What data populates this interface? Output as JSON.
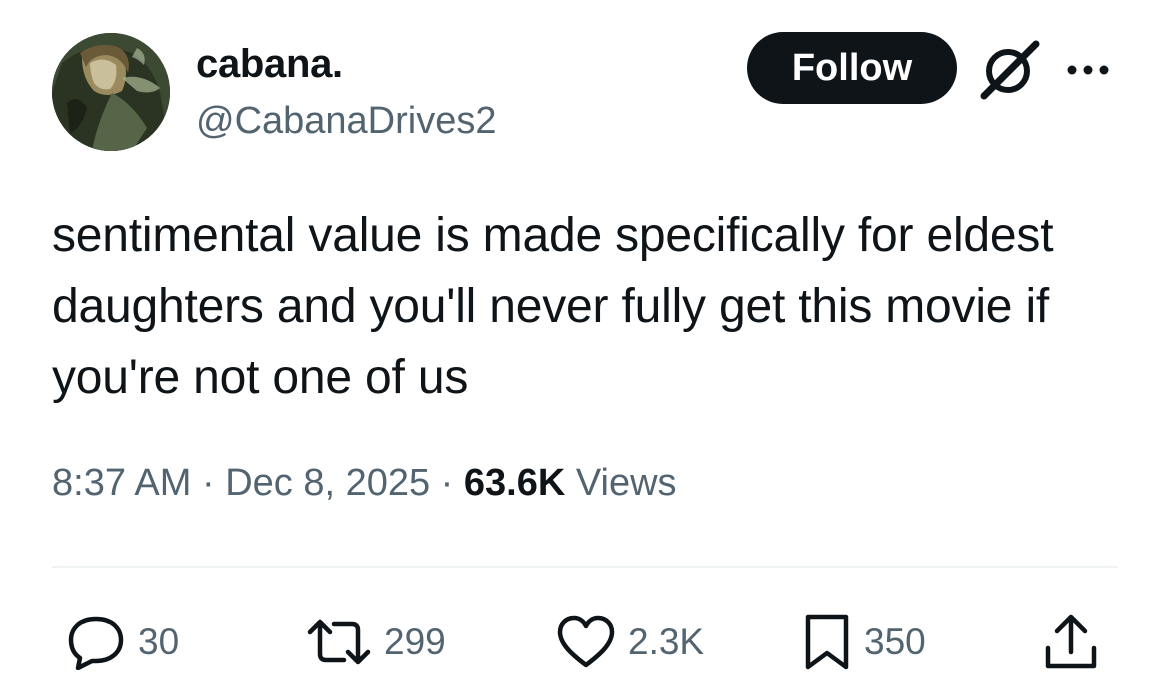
{
  "author": {
    "display_name": "cabana.",
    "handle": "@CabanaDrives2",
    "avatar_icon": "anime-character-avatar"
  },
  "header_actions": {
    "follow_label": "Follow",
    "grok_icon": "grok-icon",
    "more_icon": "more-icon"
  },
  "tweet": {
    "text": "sentimental value is made specifically for eldest daughters and you'll never fully get this movie if you're not one of us",
    "time": "8:37 AM",
    "sep1": " · ",
    "date": "Dec 8, 2025",
    "sep2": " · ",
    "views_count": "63.6K",
    "views_label": " Views"
  },
  "actions": {
    "replies": "30",
    "retweets": "299",
    "likes": "2.3K",
    "bookmarks": "350"
  },
  "colors": {
    "text_primary": "#0f1419",
    "text_secondary": "#536471",
    "follow_bg": "#0f1419",
    "divider": "#eff3f4"
  }
}
